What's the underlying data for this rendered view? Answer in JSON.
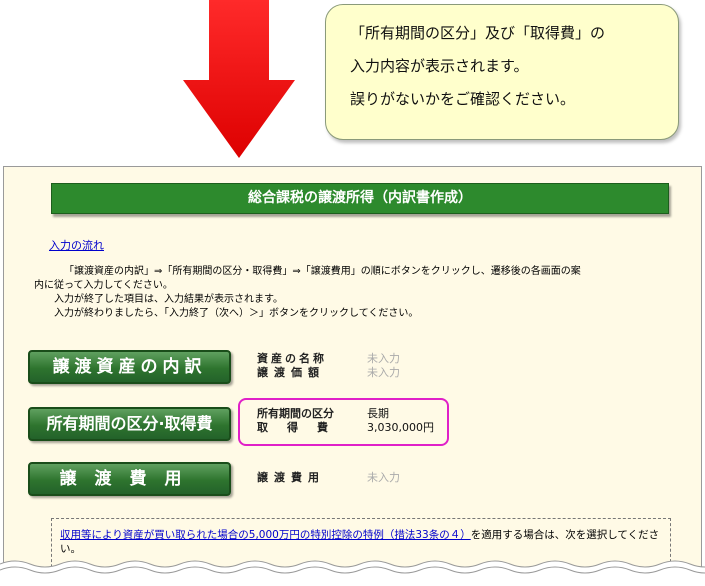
{
  "callout": {
    "lines": [
      "「所有期間の区分」及び「取得費」の",
      "入力内容が表示されます。",
      "誤りがないかをご確認ください。"
    ]
  },
  "title": "総合課税の譲渡所得（内訳書作成）",
  "flow_link": "入力の流れ",
  "intro": [
    "「譲渡資産の内訳」⇒「所有期間の区分・取得費」⇒「譲渡費用」の順にボタンをクリックし、遷移後の各画面の案",
    "内に従って入力してください。",
    "入力が終了した項目は、入力結果が表示されます。",
    "入力が終わりましたら、「入力終了（次へ）＞」ボタンをクリックしてください。"
  ],
  "buttons": {
    "asset": "譲渡資産の内訳",
    "period": "所有期間の区分·取得費",
    "cost": "譲渡費用"
  },
  "asset_info": {
    "name_label": "資産の名称",
    "name_value": "未入力",
    "price_label": "譲渡価額",
    "price_value": "未入力"
  },
  "period_info": {
    "period_label": "所有期間の区分",
    "period_value": "長期",
    "cost_label": "取　得　費",
    "cost_value": "3,030,000円"
  },
  "cost_info": {
    "label": "譲渡費用",
    "value": "未入力"
  },
  "notice": {
    "link": "収用等により資産が買い取られた場合の5,000万円の特別控除の特例（措法33条の４）",
    "text": "を適用する場合は、次を選択してください。"
  },
  "colors": {
    "arrow": "#ee1111",
    "title_bar": "#2d8a2d",
    "highlight": "#e020c8",
    "panel_bg": "#fffae6",
    "callout_bg": "#ffffcc"
  }
}
